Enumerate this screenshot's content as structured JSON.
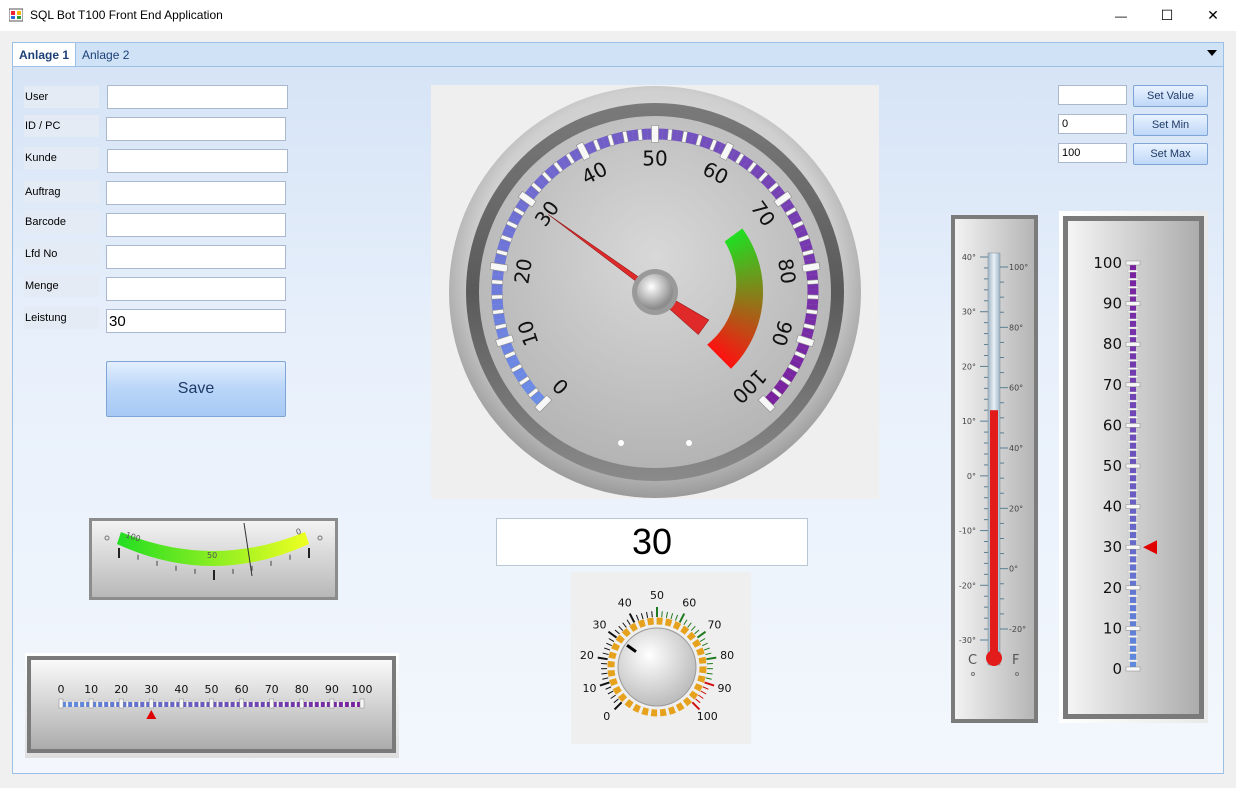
{
  "window": {
    "title": "SQL Bot T100 Front End Application",
    "minimize_glyph": "—",
    "maximize_glyph": "☐",
    "close_glyph": "✕"
  },
  "tabs": [
    {
      "label": "Anlage 1",
      "active": true
    },
    {
      "label": "Anlage 2",
      "active": false
    }
  ],
  "form": {
    "fields": [
      {
        "label": "User",
        "value": ""
      },
      {
        "label": "ID / PC",
        "value": ""
      },
      {
        "label": "Kunde",
        "value": ""
      },
      {
        "label": "Auftrag",
        "value": ""
      },
      {
        "label": "Barcode",
        "value": ""
      },
      {
        "label": "Lfd No",
        "value": ""
      },
      {
        "label": "Menge",
        "value": ""
      },
      {
        "label": "Leistung",
        "value": "30"
      }
    ],
    "save_label": "Save"
  },
  "controls": {
    "value_input": "",
    "min_input": "0",
    "max_input": "100",
    "set_value_label": "Set  Value",
    "set_min_label": "Set Min",
    "set_max_label": "Set Max"
  },
  "main_gauge": {
    "min": 0,
    "max": 100,
    "value": 30,
    "labels": [
      "0",
      "10",
      "20",
      "30",
      "40",
      "50",
      "60",
      "70",
      "80",
      "90",
      "100"
    ],
    "readout": "30",
    "accent_low": "#6b8ee8",
    "accent_high": "#7a1f9e"
  },
  "horizontal_meter": {
    "labels": [
      "100",
      "50",
      "0"
    ],
    "value": 30
  },
  "linear_scale": {
    "labels": [
      "0",
      "10",
      "20",
      "30",
      "40",
      "50",
      "60",
      "70",
      "80",
      "90",
      "100"
    ],
    "value": 30
  },
  "knob": {
    "labels": [
      "0",
      "10",
      "20",
      "30",
      "40",
      "50",
      "60",
      "70",
      "80",
      "90",
      "100"
    ],
    "value": 30
  },
  "thermometer": {
    "celsius_labels": [
      "40°",
      "30°",
      "20°",
      "10°",
      "0°",
      "-10°",
      "-20°",
      "-30°"
    ],
    "fahrenheit_labels": [
      "100°",
      "80°",
      "60°",
      "40°",
      "20°",
      "0°",
      "-20°"
    ],
    "unit_c": "C",
    "unit_f": "F",
    "level_celsius": 12
  },
  "vertical_scale": {
    "labels": [
      "100",
      "90",
      "80",
      "70",
      "60",
      "50",
      "40",
      "30",
      "20",
      "10",
      "0"
    ],
    "value": 30
  }
}
